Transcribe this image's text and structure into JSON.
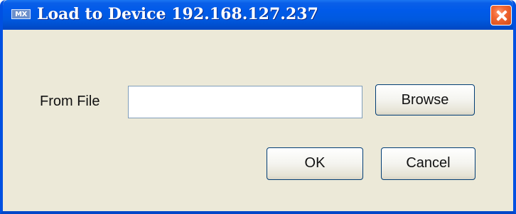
{
  "window": {
    "app_icon_text": "MX",
    "title": "Load to Device 192.168.127.237"
  },
  "form": {
    "from_file_label": "From File",
    "from_file_value": "",
    "browse_label": "Browse"
  },
  "actions": {
    "ok_label": "OK",
    "cancel_label": "Cancel"
  },
  "colors": {
    "title_bar": "#0059df",
    "dialog_background": "#ece9d8",
    "close_button": "#e55a24",
    "button_border": "#003c74"
  }
}
